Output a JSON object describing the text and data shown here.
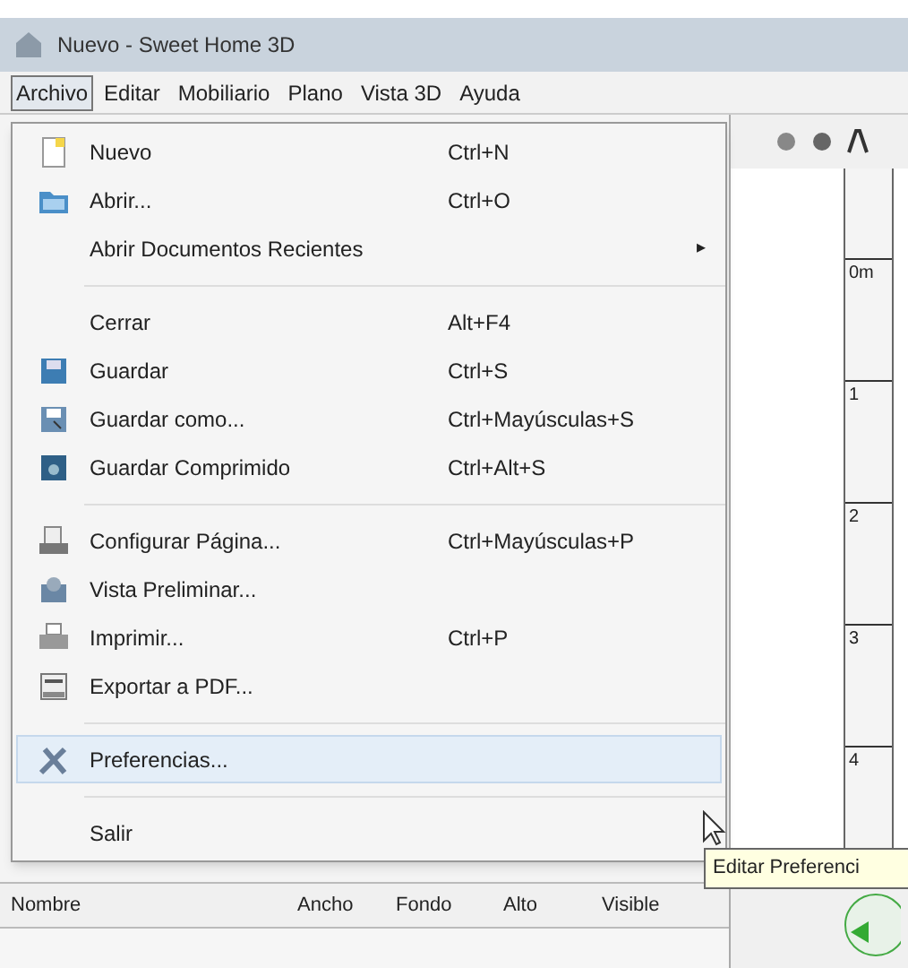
{
  "window": {
    "title": "Nuevo - Sweet Home 3D"
  },
  "menubar": [
    {
      "label": "Archivo",
      "selected": true
    },
    {
      "label": "Editar",
      "selected": false
    },
    {
      "label": "Mobiliario",
      "selected": false
    },
    {
      "label": "Plano",
      "selected": false
    },
    {
      "label": "Vista 3D",
      "selected": false
    },
    {
      "label": "Ayuda",
      "selected": false
    }
  ],
  "menu": [
    {
      "kind": "item",
      "label": "Nuevo",
      "shortcut": "Ctrl+N",
      "selected": false
    },
    {
      "kind": "item",
      "label": "Abrir...",
      "shortcut": "Ctrl+O",
      "selected": false
    },
    {
      "kind": "submenu",
      "label": "Abrir Documentos Recientes",
      "arrow": "▸",
      "selected": false
    },
    {
      "kind": "separator"
    },
    {
      "kind": "item",
      "label": "Cerrar",
      "shortcut": "Alt+F4",
      "selected": false
    },
    {
      "kind": "item",
      "label": "Guardar",
      "shortcut": "Ctrl+S",
      "selected": false
    },
    {
      "kind": "item",
      "label": "Guardar como...",
      "shortcut": "Ctrl+Mayúsculas+S",
      "selected": false
    },
    {
      "kind": "item",
      "label": "Guardar Comprimido",
      "shortcut": "Ctrl+Alt+S",
      "selected": false
    },
    {
      "kind": "separator"
    },
    {
      "kind": "item",
      "label": "Configurar Página...",
      "shortcut": "Ctrl+Mayúsculas+P",
      "selected": false
    },
    {
      "kind": "item",
      "label": "Vista Preliminar...",
      "selected": false
    },
    {
      "kind": "item",
      "label": "Imprimir...",
      "shortcut": "Ctrl+P",
      "selected": false
    },
    {
      "kind": "item",
      "label": "Exportar a PDF...",
      "selected": false
    },
    {
      "kind": "separator"
    },
    {
      "kind": "item",
      "label": "Preferencias...",
      "selected": true
    },
    {
      "kind": "separator"
    },
    {
      "kind": "item",
      "label": "Salir",
      "selected": false
    }
  ],
  "tooltip": "Editar Preferenci",
  "ruler": [
    "0m",
    "1",
    "2",
    "3",
    "4"
  ],
  "table": {
    "columns": [
      "Nombre",
      "Ancho",
      "Fondo",
      "Alto",
      "Visible"
    ]
  }
}
